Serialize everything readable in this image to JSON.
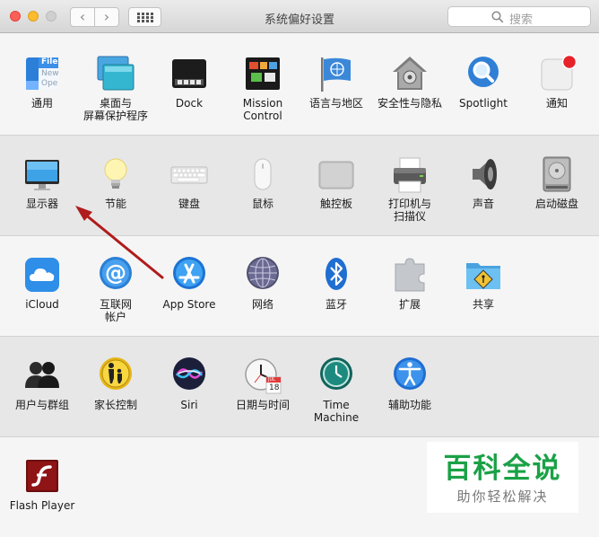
{
  "window": {
    "title": "系统偏好设置"
  },
  "search": {
    "placeholder": "搜索"
  },
  "rows": [
    [
      {
        "id": "general",
        "label": "通用",
        "icon": "general-icon",
        "ic_text": [
          "File",
          "New",
          "Ope"
        ]
      },
      {
        "id": "desktop",
        "label": "桌面与\n屏幕保护程序",
        "icon": "desktop-screensaver-icon"
      },
      {
        "id": "dock",
        "label": "Dock",
        "icon": "dock-icon"
      },
      {
        "id": "mission",
        "label": "Mission\nControl",
        "icon": "mission-control-icon"
      },
      {
        "id": "language",
        "label": "语言与地区",
        "icon": "language-region-flag-icon"
      },
      {
        "id": "security",
        "label": "安全性与隐私",
        "icon": "security-house-icon"
      },
      {
        "id": "spotlight",
        "label": "Spotlight",
        "icon": "spotlight-magnifier-icon"
      },
      {
        "id": "notifications",
        "label": "通知",
        "icon": "notifications-icon"
      }
    ],
    [
      {
        "id": "displays",
        "label": "显示器",
        "icon": "display-monitor-icon"
      },
      {
        "id": "energy",
        "label": "节能",
        "icon": "energy-bulb-icon"
      },
      {
        "id": "keyboard",
        "label": "键盘",
        "icon": "keyboard-icon"
      },
      {
        "id": "mouse",
        "label": "鼠标",
        "icon": "mouse-icon"
      },
      {
        "id": "trackpad",
        "label": "触控板",
        "icon": "trackpad-icon"
      },
      {
        "id": "printers",
        "label": "打印机与\n扫描仪",
        "icon": "printer-icon"
      },
      {
        "id": "sound",
        "label": "声音",
        "icon": "speaker-icon"
      },
      {
        "id": "startup",
        "label": "启动磁盘",
        "icon": "hard-disk-icon"
      }
    ],
    [
      {
        "id": "icloud",
        "label": "iCloud",
        "icon": "icloud-icon"
      },
      {
        "id": "internet",
        "label": "互联网\n帐户",
        "icon": "internet-accounts-at-icon"
      },
      {
        "id": "appstore",
        "label": "App Store",
        "icon": "app-store-icon"
      },
      {
        "id": "network",
        "label": "网络",
        "icon": "network-globe-icon"
      },
      {
        "id": "bluetooth",
        "label": "蓝牙",
        "icon": "bluetooth-icon"
      },
      {
        "id": "extensions",
        "label": "扩展",
        "icon": "extensions-puzzle-icon"
      },
      {
        "id": "sharing",
        "label": "共享",
        "icon": "sharing-folder-icon"
      }
    ],
    [
      {
        "id": "users",
        "label": "用户与群组",
        "icon": "users-groups-icon"
      },
      {
        "id": "parental",
        "label": "家长控制",
        "icon": "parental-controls-icon"
      },
      {
        "id": "siri",
        "label": "Siri",
        "icon": "siri-icon"
      },
      {
        "id": "datetime",
        "label": "日期与时间",
        "icon": "clock-calendar-icon",
        "ic_text": [
          "JUL",
          "18"
        ]
      },
      {
        "id": "timemachine",
        "label": "Time Machine",
        "icon": "time-machine-icon"
      },
      {
        "id": "accessibility",
        "label": "辅助功能",
        "icon": "accessibility-icon"
      }
    ],
    [
      {
        "id": "flash",
        "label": "Flash Player",
        "icon": "flash-player-icon"
      }
    ]
  ],
  "watermark": {
    "title": "百科全说",
    "subtitle": "助你轻松解决"
  },
  "colors": {
    "annotation_arrow": "#b01c1c",
    "watermark_green": "#1aa146"
  }
}
